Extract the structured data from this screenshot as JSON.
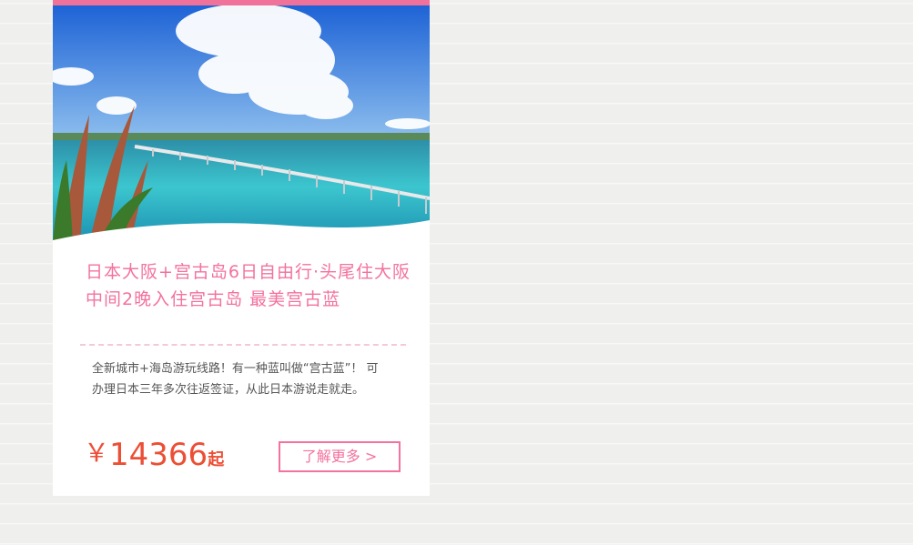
{
  "card": {
    "image_alt": "Island bridge over turquoise sea",
    "title": "日本大阪+宫古岛6日自由行·头尾住大阪 中间2晚入住宫古岛 最美宫古蓝",
    "description": "全新城市+海岛游玩线路！有一种蓝叫做“宫古蓝”！ 可办理日本三年多次往返签证，从此日本游说走就走。",
    "price": {
      "currency": "￥",
      "value": "14366",
      "suffix": "起"
    },
    "more_label": "了解更多 >"
  },
  "colors": {
    "accent_pink": "#f0719a",
    "price_red": "#ec4f35",
    "text_gray": "#555555"
  }
}
